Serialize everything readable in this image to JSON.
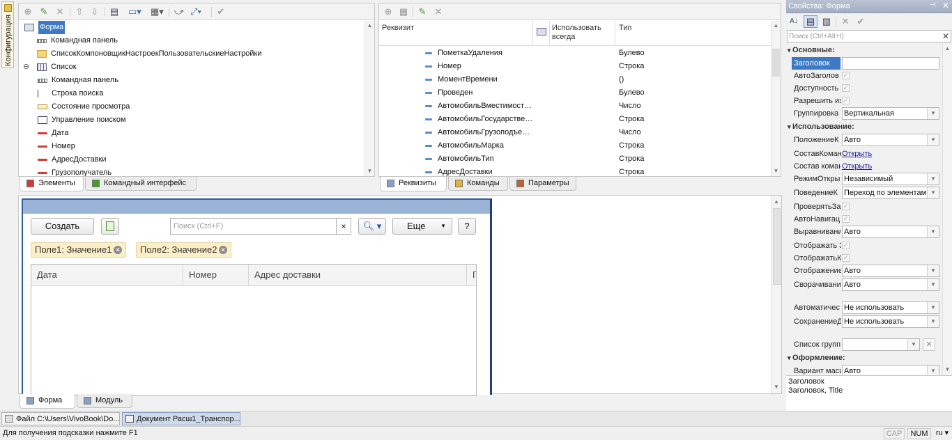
{
  "left_rail": {
    "config_tab": "Конфигурация"
  },
  "elements_tree": {
    "items": [
      {
        "label": "Форма",
        "icon": "form-icon",
        "selected": true
      },
      {
        "label": "Командная панель",
        "icon": "command-bar-icon"
      },
      {
        "label": "СписокКомпоновщикНастроекПользовательскиеНастройки",
        "icon": "folder-icon"
      },
      {
        "label": "Список",
        "icon": "table-icon",
        "expander": "⊖"
      },
      {
        "label": "Командная панель",
        "icon": "command-bar-icon"
      },
      {
        "label": "Строка поиска",
        "icon": "search-string-icon"
      },
      {
        "label": "Состояние просмотра",
        "icon": "view-state-icon"
      },
      {
        "label": "Управление поиском",
        "icon": "search-control-icon"
      },
      {
        "label": "Дата",
        "icon": "field-icon"
      },
      {
        "label": "Номер",
        "icon": "field-icon"
      },
      {
        "label": "АдресДоставки",
        "icon": "field-icon"
      },
      {
        "label": "Грузополучатель",
        "icon": "field-icon"
      }
    ],
    "tabs": [
      "Элементы",
      "Командный интерфейс"
    ]
  },
  "attributes": {
    "headers": {
      "name": "Реквизит",
      "use_always": "Использовать всегда",
      "type": "Тип"
    },
    "rows": [
      {
        "name": "ПометкаУдаления",
        "type": "Булево"
      },
      {
        "name": "Номер",
        "type": "Строка"
      },
      {
        "name": "МоментВремени",
        "type": "()"
      },
      {
        "name": "Проведен",
        "type": "Булево"
      },
      {
        "name": "АвтомобильВместимост…",
        "type": "Число"
      },
      {
        "name": "АвтомобильГосударстве…",
        "type": "Строка"
      },
      {
        "name": "АвтомобильГрузоподъе…",
        "type": "Число"
      },
      {
        "name": "АвтомобильМарка",
        "type": "Строка"
      },
      {
        "name": "АвтомобильТип",
        "type": "Строка"
      },
      {
        "name": "АдресДоставки",
        "type": "Строка"
      }
    ],
    "tabs": [
      "Реквизиты",
      "Команды",
      "Параметры"
    ]
  },
  "form_preview": {
    "create_button": "Создать",
    "search_placeholder": "Поиск (Ctrl+F)",
    "search_clear": "×",
    "more_button": "Еще",
    "help_button": "?",
    "chips": [
      "Поле1: Значение1",
      "Поле2: Значение2"
    ],
    "columns": [
      "Дата",
      "Номер",
      "Адрес доставки",
      "Г"
    ],
    "tabs": [
      "Форма",
      "Модуль"
    ]
  },
  "properties": {
    "title": "Свойства: Форма",
    "search_placeholder": "Поиск (Ctrl+Alt+I)",
    "sections": {
      "main": "Основные:",
      "usage": "Использование:",
      "appearance": "Оформление:"
    },
    "main_rows": [
      {
        "label": "Заголовок",
        "kind": "text",
        "value": ""
      },
      {
        "label": "АвтоЗаголов",
        "kind": "check",
        "value": "✓"
      },
      {
        "label": "Доступность",
        "kind": "check",
        "value": "✓"
      },
      {
        "label": "Разрешить из",
        "kind": "check",
        "value": "✓"
      },
      {
        "label": "Группировка",
        "kind": "select",
        "value": "Вертикальная"
      }
    ],
    "usage_rows": [
      {
        "label": "ПоложениеК",
        "kind": "select",
        "value": "Авто"
      },
      {
        "label": "СоставКоман",
        "kind": "link",
        "value": "Открыть"
      },
      {
        "label": "Состав коман",
        "kind": "link",
        "value": "Открыть"
      },
      {
        "label": "РежимОткры",
        "kind": "select",
        "value": "Независимый"
      },
      {
        "label": "ПоведениеК",
        "kind": "select",
        "value": "Переход по элементам"
      },
      {
        "label": "ПроверятьЗа",
        "kind": "check",
        "value": "✓"
      },
      {
        "label": "АвтоНавигац",
        "kind": "check",
        "value": "✓"
      },
      {
        "label": "Выравнивани",
        "kind": "select",
        "value": "Авто"
      },
      {
        "label": "Отображать З",
        "kind": "check",
        "value": "✓"
      },
      {
        "label": "ОтображатьК",
        "kind": "check",
        "value": "✓"
      },
      {
        "label": "Отображение",
        "kind": "select",
        "value": "Авто"
      },
      {
        "label": "Сворачивани",
        "kind": "select",
        "value": "Авто"
      }
    ],
    "auto_rows": [
      {
        "label": "Автоматичес",
        "value": "Не использовать"
      },
      {
        "label": "СохранениеД",
        "value": "Не использовать"
      }
    ],
    "group_list_label": "Список групп",
    "appearance_row": {
      "label": "Вариант масш",
      "value": "Авто"
    },
    "description_title": "Заголовок",
    "description_text": "Заголовок, Title"
  },
  "taskbar": {
    "items": [
      "Файл C:\\Users\\VivoBook\\Do...",
      "Документ Расш1_Транспор..."
    ]
  },
  "status": {
    "hint": "Для получения подсказки нажмите F1",
    "cap": "CAP",
    "num": "NUM",
    "lang": "ru ▾"
  }
}
